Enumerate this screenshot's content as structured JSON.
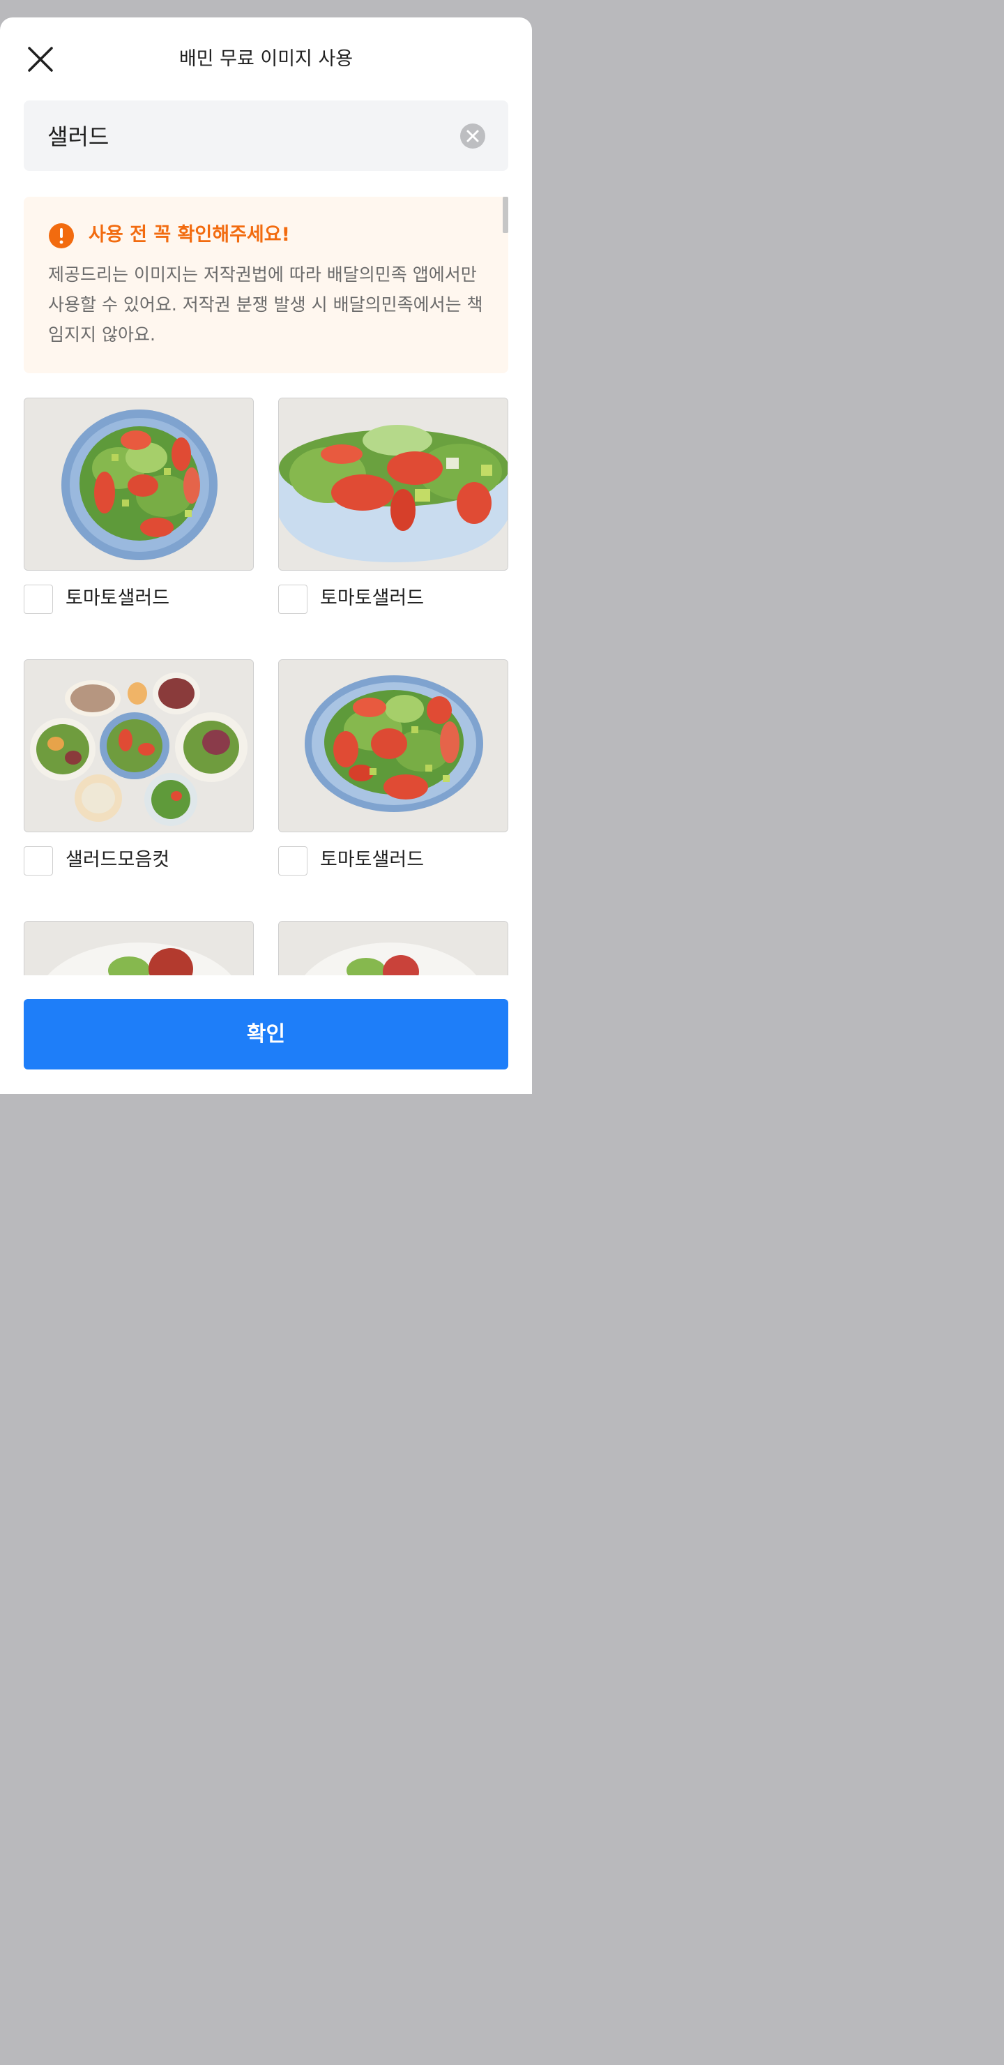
{
  "header": {
    "title": "배민 무료 이미지 사용"
  },
  "search": {
    "value": "샐러드"
  },
  "notice": {
    "title": "사용 전 꼭 확인해주세요!",
    "body": "제공드리는 이미지는 저작권법에 따라 배달의민족 앱에서만 사용할 수 있어요. 저작권 분쟁 발생 시 배달의민족에서는 책임지지 않아요."
  },
  "images": [
    {
      "label": "토마토샐러드",
      "style": "top-view"
    },
    {
      "label": "토마토샐러드",
      "style": "side-view"
    },
    {
      "label": "샐러드모음컷",
      "style": "collection"
    },
    {
      "label": "토마토샐러드",
      "style": "top-view"
    },
    {
      "label": "",
      "style": "partial"
    },
    {
      "label": "",
      "style": "partial"
    }
  ],
  "footer": {
    "confirm_label": "확인"
  },
  "colors": {
    "accent": "#1e7ef9",
    "warning": "#f26b0f",
    "notice_bg": "#fff7ef",
    "search_bg": "#f3f4f6"
  }
}
